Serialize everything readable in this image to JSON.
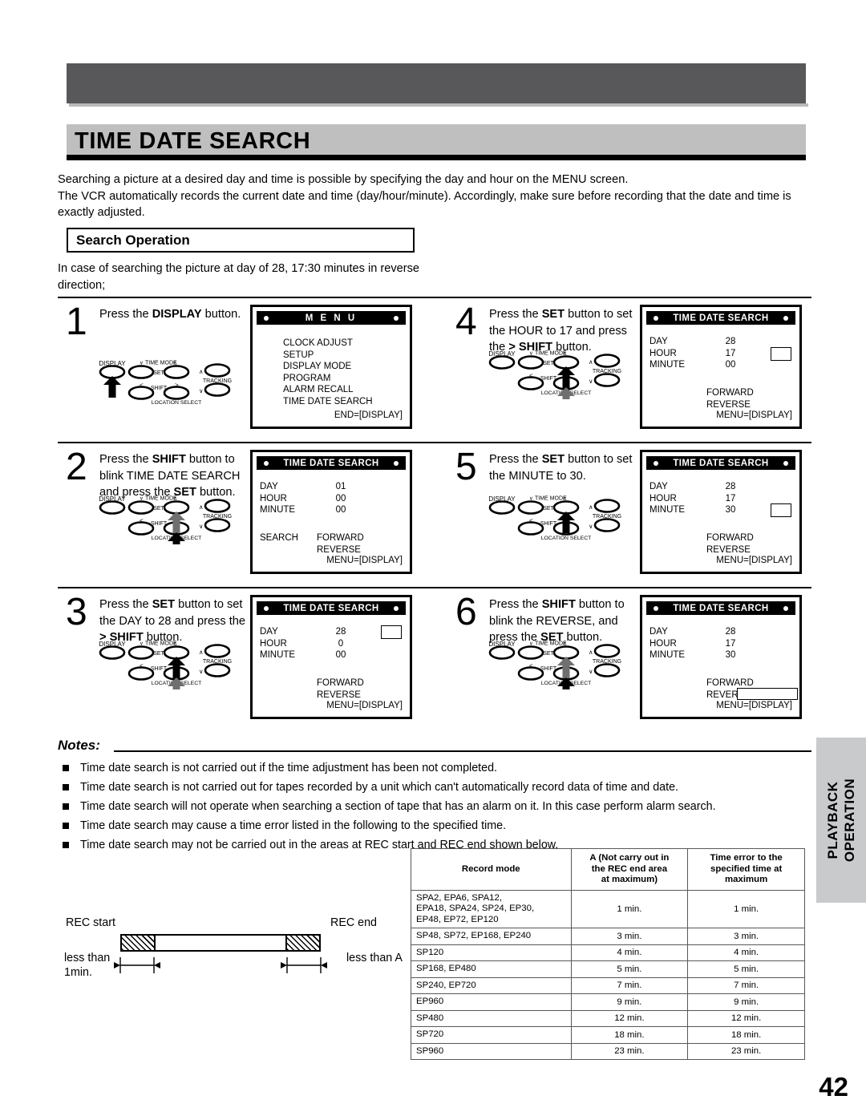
{
  "page": {
    "title": "TIME DATE SEARCH",
    "number": "42",
    "side_tab_line1": "PLAYBACK",
    "side_tab_line2": "OPERATION"
  },
  "intro": {
    "line1": "Searching a picture at a desired day and time is possible by specifying the day and hour on the MENU screen.",
    "line2": "The VCR automatically records the current date and time (day/hour/minute). Accordingly, make sure before recording that the date and time is exactly adjusted."
  },
  "section": {
    "heading": "Search Operation",
    "case_text": "In case of searching the picture at day of 28, 17:30 minutes in reverse direction;"
  },
  "remote_labels": {
    "display": "DISPLAY",
    "time_mode": "TIME MODE",
    "set": "SET",
    "shift": "SHIFT",
    "tracking": "TRACKING",
    "location_select": "LOCATION SELECT",
    "minus": "_",
    "plus": "+",
    "left": "<",
    "right": ">"
  },
  "steps": [
    {
      "num": "1",
      "text_parts": [
        {
          "t": "Press the ",
          "b": false
        },
        {
          "t": "DISPLAY",
          "b": true
        },
        {
          "t": " button.",
          "b": false
        }
      ],
      "osd": {
        "type": "menu",
        "title": "M E N U",
        "items": [
          "CLOCK ADJUST",
          "SETUP",
          "DISPLAY MODE",
          "PROGRAM",
          "ALARM RECALL",
          "TIME DATE SEARCH"
        ],
        "footer": "END=[DISPLAY]"
      },
      "arrows": [
        {
          "key": "display",
          "shade": "black"
        }
      ]
    },
    {
      "num": "2",
      "text_parts": [
        {
          "t": "Press the ",
          "b": false
        },
        {
          "t": "SHIFT",
          "b": true
        },
        {
          "t": " button to blink TIME DATE SEARCH and press the ",
          "b": false
        },
        {
          "t": "SET",
          "b": true
        },
        {
          "t": " button.",
          "b": false
        }
      ],
      "osd": {
        "type": "tds",
        "title": "TIME DATE SEARCH",
        "rows": [
          {
            "label": "DAY",
            "value": "01"
          },
          {
            "label": "HOUR",
            "value": "00"
          },
          {
            "label": "MINUTE",
            "value": "00"
          }
        ],
        "search_label": "SEARCH",
        "forward": "FORWARD",
        "reverse": "REVERSE",
        "footer": "MENU=[DISPLAY]",
        "cursor": "none"
      },
      "arrows": [
        {
          "key": "set_up",
          "shade": "gray"
        },
        {
          "key": "shift_right",
          "shade": "black"
        }
      ]
    },
    {
      "num": "3",
      "text_parts": [
        {
          "t": "Press the ",
          "b": false
        },
        {
          "t": "SET",
          "b": true
        },
        {
          "t": " button to set the DAY to 28 and press the ",
          "b": false
        },
        {
          "t": "> SHIFT",
          "b": true
        },
        {
          "t": " button.",
          "b": false
        }
      ],
      "osd": {
        "type": "tds",
        "title": "TIME DATE SEARCH",
        "rows": [
          {
            "label": "DAY",
            "value": "28"
          },
          {
            "label": "HOUR",
            "value": "0"
          },
          {
            "label": "MINUTE",
            "value": "00"
          }
        ],
        "search_label": "",
        "forward": "FORWARD",
        "reverse": "REVERSE",
        "footer": "MENU=[DISPLAY]",
        "cursor": "day"
      },
      "arrows": [
        {
          "key": "set_up",
          "shade": "black"
        },
        {
          "key": "shift_right",
          "shade": "gray"
        }
      ]
    },
    {
      "num": "4",
      "text_parts": [
        {
          "t": "Press the ",
          "b": false
        },
        {
          "t": "SET",
          "b": true
        },
        {
          "t": " button to set the HOUR to 17 and press the ",
          "b": false
        },
        {
          "t": "> SHIFT",
          "b": true
        },
        {
          "t": " button.",
          "b": false
        }
      ],
      "osd": {
        "type": "tds",
        "title": "TIME DATE SEARCH",
        "rows": [
          {
            "label": "DAY",
            "value": "28"
          },
          {
            "label": "HOUR",
            "value": "17"
          },
          {
            "label": "MINUTE",
            "value": "00"
          }
        ],
        "search_label": "",
        "forward": "FORWARD",
        "reverse": "REVERSE",
        "footer": "MENU=[DISPLAY]",
        "cursor": "hour"
      },
      "arrows": [
        {
          "key": "set_up",
          "shade": "black"
        },
        {
          "key": "shift_right",
          "shade": "gray"
        }
      ]
    },
    {
      "num": "5",
      "text_parts": [
        {
          "t": "Press the ",
          "b": false
        },
        {
          "t": "SET",
          "b": true
        },
        {
          "t": " button to set the MINUTE to 30.",
          "b": false
        }
      ],
      "osd": {
        "type": "tds",
        "title": "TIME DATE SEARCH",
        "rows": [
          {
            "label": "DAY",
            "value": "28"
          },
          {
            "label": "HOUR",
            "value": "17"
          },
          {
            "label": "MINUTE",
            "value": "30"
          }
        ],
        "search_label": "",
        "forward": "FORWARD",
        "reverse": "REVERSE",
        "footer": "MENU=[DISPLAY]",
        "cursor": "minute"
      },
      "arrows": [
        {
          "key": "set_up",
          "shade": "black"
        }
      ]
    },
    {
      "num": "6",
      "text_parts": [
        {
          "t": "Press the ",
          "b": false
        },
        {
          "t": "SHIFT",
          "b": true
        },
        {
          "t": " button to blink the REVERSE, and press the ",
          "b": false
        },
        {
          "t": "SET",
          "b": true
        },
        {
          "t": " button.",
          "b": false
        }
      ],
      "osd": {
        "type": "tds",
        "title": "TIME DATE SEARCH",
        "rows": [
          {
            "label": "DAY",
            "value": "28"
          },
          {
            "label": "HOUR",
            "value": "17"
          },
          {
            "label": "MINUTE",
            "value": "30"
          }
        ],
        "search_label": "",
        "forward": "FORWARD",
        "reverse": "REVERSE",
        "footer": "MENU=[DISPLAY]",
        "cursor": "reverse"
      },
      "arrows": [
        {
          "key": "set_up",
          "shade": "gray"
        },
        {
          "key": "shift_right",
          "shade": "black"
        }
      ]
    }
  ],
  "notes": {
    "heading": "Notes:",
    "items": [
      "Time date search is not carried out if the time adjustment has been not completed.",
      "Time date search is not carried out for tapes recorded by a unit which can't automatically record data of time and date.",
      "Time date search will not operate when searching a section of tape that has an alarm on it. In this case perform alarm search.",
      "Time date search may cause a time error listed in the following to the specified time.",
      "Time date search may not be carried out in the areas at REC start and REC end shown below."
    ]
  },
  "rec_diagram": {
    "rec_start": "REC start",
    "rec_end": "REC end",
    "left_label_line1": "less than",
    "left_label_line2": "1min.",
    "right_label": "less than A"
  },
  "spec_table": {
    "headers": [
      "Record mode",
      "A (Not carry out in the REC end area at maximum)",
      "Time error to the specified time at maximum"
    ],
    "header_lines": [
      [
        "Record mode"
      ],
      [
        "A (Not carry out in",
        "the REC end area",
        "at maximum)"
      ],
      [
        "Time error to the",
        "specified time at",
        "maximum"
      ]
    ],
    "rows": [
      {
        "mode_lines": [
          "SPA2, EPA6, SPA12,",
          "EPA18, SPA24, SP24, EP30,",
          "EP48, EP72, EP120"
        ],
        "a": "1 min.",
        "err": "1 min."
      },
      {
        "mode_lines": [
          "SP48, SP72, EP168, EP240"
        ],
        "a": "3 min.",
        "err": "3 min."
      },
      {
        "mode_lines": [
          "SP120"
        ],
        "a": "4 min.",
        "err": "4 min."
      },
      {
        "mode_lines": [
          "SP168, EP480"
        ],
        "a": "5 min.",
        "err": "5 min."
      },
      {
        "mode_lines": [
          "SP240, EP720"
        ],
        "a": "7 min.",
        "err": "7 min."
      },
      {
        "mode_lines": [
          "EP960"
        ],
        "a": "9 min.",
        "err": "9 min."
      },
      {
        "mode_lines": [
          "SP480"
        ],
        "a": "12 min.",
        "err": "12 min."
      },
      {
        "mode_lines": [
          "SP720"
        ],
        "a": "18 min.",
        "err": "18 min."
      },
      {
        "mode_lines": [
          "SP960"
        ],
        "a": "23 min.",
        "err": "23 min."
      }
    ]
  },
  "colors": {
    "header_bar": "#58585b",
    "title_band": "#bfbfbf",
    "side_tab": "#c9cacc"
  }
}
